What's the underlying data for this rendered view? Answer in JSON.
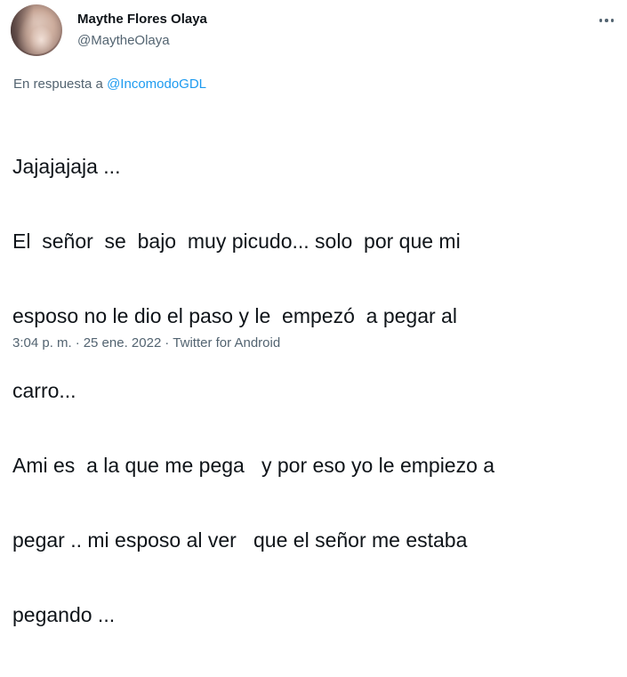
{
  "author": {
    "display_name": "Maythe Flores Olaya",
    "handle": "@MaytheOlaya"
  },
  "more_icon": "more-horizontal-icon",
  "reply": {
    "prefix": "En respuesta a ",
    "mention": "@IncomodoGDL"
  },
  "tweet": {
    "lines": [
      "Jajajajaja ...",
      "El  señor  se  bajo  muy picudo... solo  por que mi",
      "esposo no le dio el paso y le  empezó  a pegar al",
      "carro...",
      "Ami es  a la que me pega   y por eso yo le empiezo a",
      "pegar .. mi esposo al ver   que el señor me estaba",
      "pegando ..."
    ]
  },
  "meta": {
    "time": "3:04 p. m.",
    "separator": "·",
    "date": "25 ene. 2022",
    "source": "Twitter for Android"
  },
  "colors": {
    "primary_text": "#0f1419",
    "secondary_text": "#536471",
    "link": "#1d9bf0"
  }
}
